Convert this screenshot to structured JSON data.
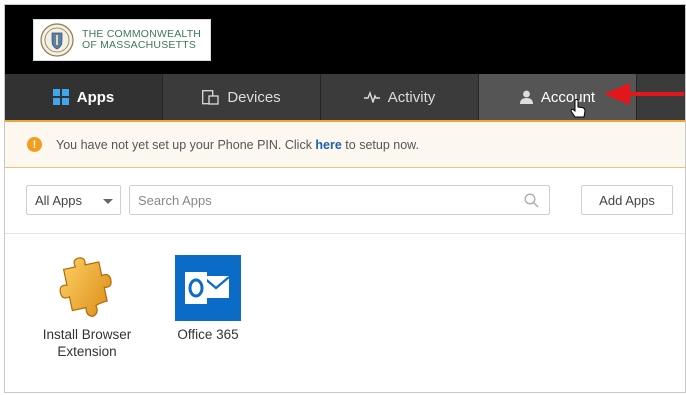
{
  "header": {
    "logo_line1": "THE COMMONWEALTH",
    "logo_line2": "OF MASSACHUSETTS",
    "logo_icon": "state-seal-icon"
  },
  "nav": {
    "tabs": [
      {
        "label": "Apps",
        "icon": "grid-icon",
        "active": true
      },
      {
        "label": "Devices",
        "icon": "devices-icon",
        "active": false
      },
      {
        "label": "Activity",
        "icon": "pulse-icon",
        "active": false
      },
      {
        "label": "Account",
        "icon": "user-icon",
        "active": false
      }
    ]
  },
  "banner": {
    "text_before": "You have not yet set up your Phone PIN. Click ",
    "link_text": "here",
    "text_after": " to setup now."
  },
  "toolbar": {
    "filter_value": "All Apps",
    "search_placeholder": "Search Apps",
    "add_button": "Add Apps"
  },
  "apps": [
    {
      "label": "Install Browser Extension",
      "icon": "puzzle-piece-icon"
    },
    {
      "label": "Office 365",
      "icon": "outlook-icon"
    }
  ],
  "colors": {
    "nav_bg": "#3b3b3b",
    "accent": "#f0a534",
    "link": "#1f5fae",
    "arrow": "#e3161c",
    "office_blue": "#0a6cc7"
  }
}
